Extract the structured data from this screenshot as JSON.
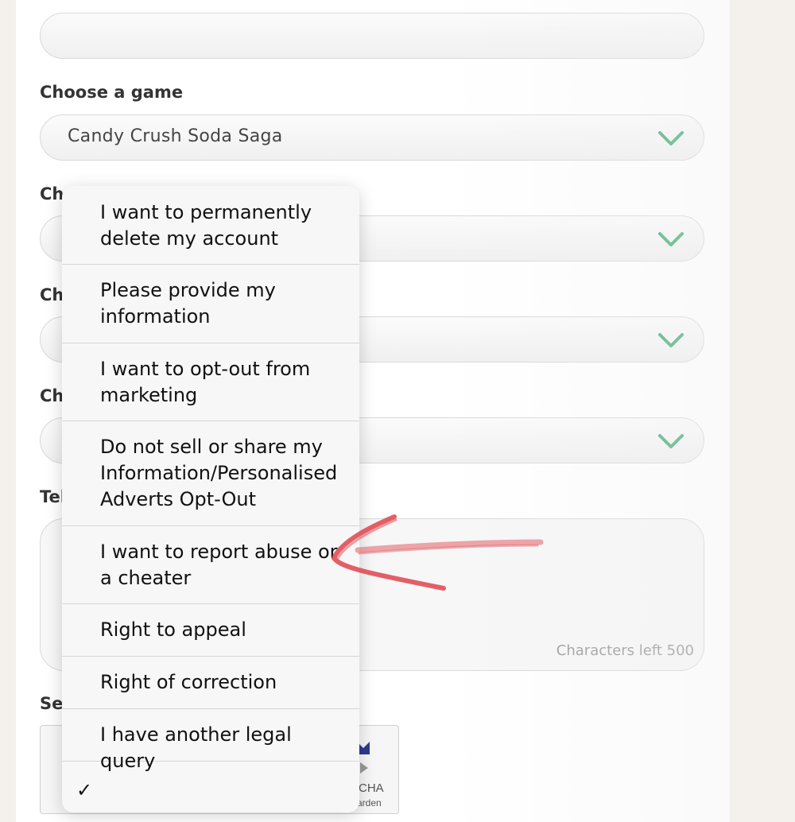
{
  "form": {
    "choose_game_label": "Choose a game",
    "game_value": "Candy Crush Soda Saga",
    "label_2_partial": "Ch",
    "label_3_partial": "Ch",
    "label_4_partial": "Ch",
    "label_5_partial": "Tel",
    "label_6_partial": "Se",
    "characters_left": "Characters left 500"
  },
  "captcha": {
    "brand_partial": "CHA",
    "sub_partial": "arden"
  },
  "dropdown": {
    "items": [
      {
        "label": "I want to permanently delete my account"
      },
      {
        "label": "Please provide my information"
      },
      {
        "label": "I want to opt-out from marketing"
      },
      {
        "label": "Do not sell or share my Information/Personalised Adverts Opt-Out"
      },
      {
        "label": "I want to report abuse or a cheater"
      },
      {
        "label": "Right to appeal"
      },
      {
        "label": "Right of correction"
      },
      {
        "label": "I have another legal query"
      }
    ],
    "check_glyph": "✓"
  },
  "colors": {
    "chevron": "#4caf7d",
    "annotation_arrow": "#e0454d"
  },
  "icons": {
    "chevron": "chevron-down-icon",
    "check": "checkmark-icon"
  }
}
